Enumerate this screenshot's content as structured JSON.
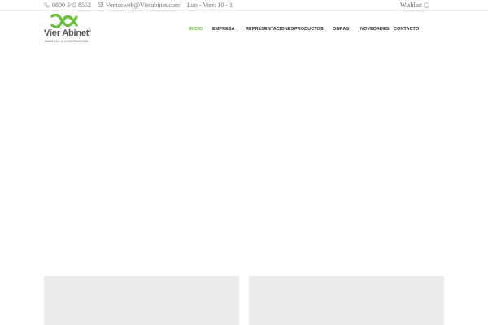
{
  "topbar": {
    "phone": {
      "icon": "phone-icon",
      "text": "0800 345 8552"
    },
    "email": {
      "icon": "envelope-icon",
      "text": "Ventasweb@Vierabinet.com"
    },
    "hours": {
      "icon": "store-icon",
      "text": "Lun - Vier: 10 - 18:"
    },
    "wishlist": {
      "label": "Wishlist",
      "icon": "circle-icon"
    }
  },
  "logo": {
    "name": "Vier Abinet",
    "registered": "®",
    "tagline": "MADERAS & CONSTRUCCIÓN",
    "brand_color": "#6cbf3c"
  },
  "nav": {
    "items": [
      {
        "label": "INICIO",
        "active": true,
        "has_dropdown": false
      },
      {
        "label": "EMPRESA",
        "active": false,
        "has_dropdown": true
      },
      {
        "label": "REPRESENTACIONES",
        "active": false,
        "has_dropdown": false
      },
      {
        "label": "PRODUCTOS",
        "active": false,
        "has_dropdown": true
      },
      {
        "label": "OBRAS",
        "active": false,
        "has_dropdown": true
      },
      {
        "label": "NOVEDADES",
        "active": false,
        "has_dropdown": false
      },
      {
        "label": "CONTACTO",
        "active": false,
        "has_dropdown": false
      }
    ],
    "chevron": "⌄",
    "active_color": "#6cbf3c"
  }
}
